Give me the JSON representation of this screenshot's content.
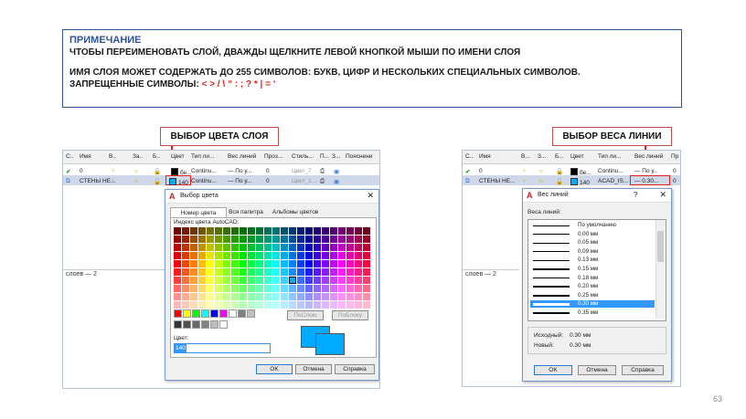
{
  "note": {
    "title": "ПРИМЕЧАНИЕ",
    "line1": "ЧТОБЫ ПЕРЕИМЕНОВАТЬ СЛОЙ, ДВАЖДЫ ЩЕЛКНИТЕ ЛЕВОЙ КНОПКОЙ МЫШИ ПО ИМЕНИ СЛОЯ",
    "line2": "ИМЯ СЛОЯ МОЖЕТ СОДЕРЖАТЬ ДО 255 СИМВОЛОВ: БУКВ, ЦИФР И НЕСКОЛЬКИХ СПЕЦИАЛЬНЫХ СИМВОЛОВ.",
    "line3_prefix": "ЗАПРЕЩЕННЫЕ СИМВОЛЫ:",
    "forbidden": "< > / \\ “ : ; ? * | = ‘"
  },
  "callouts": {
    "left": "ВЫБОР ЦВЕТА СЛОЯ",
    "right": "ВЫБОР ВЕСА ЛИНИИ"
  },
  "left_manager": {
    "headers": [
      "С..",
      "Имя",
      "В..",
      "За..",
      "Б..",
      "Цвет",
      "Тип ли...",
      "Вес линий",
      "Проз...",
      "Стиль...",
      "П...",
      "З...",
      "Пояснени"
    ],
    "rows": [
      {
        "name": "0",
        "color": "бе...",
        "ltype": "Continu...",
        "lweight": "— По у...",
        "transp": "0",
        "style": "Цвет_7"
      },
      {
        "name": "СТЕНЫ НЕ...",
        "color": "140",
        "ltype": "Continu...",
        "lweight": "— По у...",
        "transp": "0",
        "style": "Цвет_1..."
      }
    ],
    "footer": "слоев — 2"
  },
  "color_dialog": {
    "title": "Выбор цвета",
    "tabs": [
      "Номер цвета",
      "Вся палитра",
      "Альбомы цветов"
    ],
    "index_label": "Индекс цвета AutoCAD:",
    "bylayer": "ПоСлою",
    "byblock": "ПоБлоку",
    "color_label": "Цвет:",
    "color_value": "140",
    "ok": "OK",
    "cancel": "Отмена",
    "help": "Справка",
    "selected_hex": "#00aaff"
  },
  "right_manager": {
    "headers": [
      "С..",
      "Имя",
      "В...",
      "З...",
      "Б...",
      "Цвет",
      "Тип ли...",
      "Вес линий",
      "Пр"
    ],
    "rows": [
      {
        "name": "0",
        "color": "бе...",
        "ltype": "Continu...",
        "lweight": "— По у..",
        "transp": "0"
      },
      {
        "name": "СТЕНЫ НЕ...",
        "color": "140",
        "ltype": "ACAD_IS...",
        "lweight": "— 0.30...",
        "transp": "0"
      }
    ],
    "footer": "слоев — 2"
  },
  "lineweight_dialog": {
    "title": "Вес линий",
    "help_q": "?",
    "list_label": "Веса линий:",
    "items": [
      "По умолчанию",
      "0.00 мм",
      "0.05 мм",
      "0.09 мм",
      "0.13 мм",
      "0.15 мм",
      "0.18 мм",
      "0.20 мм",
      "0.25 мм",
      "0.30 мм",
      "0.35 мм"
    ],
    "selected_index": 9,
    "original_label": "Исходный:",
    "original_value": "0.30 мм",
    "new_label": "Новый:",
    "new_value": "0.30 мм",
    "ok": "OK",
    "cancel": "Отмена",
    "help": "Справка"
  },
  "page_number": "63"
}
